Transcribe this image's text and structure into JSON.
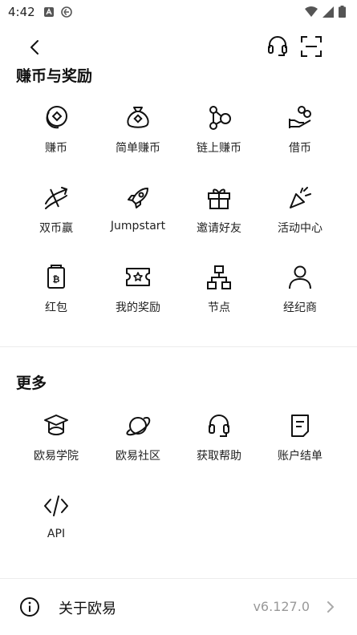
{
  "status_bar": {
    "time": "4:42"
  },
  "sections": {
    "earn": {
      "title": "赚币与奖励",
      "items": [
        {
          "label": "赚币",
          "icon": "coins-icon"
        },
        {
          "label": "简单赚币",
          "icon": "money-bag-icon"
        },
        {
          "label": "链上赚币",
          "icon": "chain-nodes-icon"
        },
        {
          "label": "借币",
          "icon": "hand-coins-icon"
        },
        {
          "label": "双币赢",
          "icon": "dual-arrows-icon"
        },
        {
          "label": "Jumpstart",
          "icon": "rocket-icon"
        },
        {
          "label": "邀请好友",
          "icon": "gift-icon"
        },
        {
          "label": "活动中心",
          "icon": "party-popper-icon"
        },
        {
          "label": "红包",
          "icon": "red-envelope-icon"
        },
        {
          "label": "我的奖励",
          "icon": "ticket-icon"
        },
        {
          "label": "节点",
          "icon": "network-node-icon"
        },
        {
          "label": "经纪商",
          "icon": "person-icon"
        }
      ]
    },
    "more": {
      "title": "更多",
      "items": [
        {
          "label": "欧易学院",
          "icon": "graduation-cap-icon"
        },
        {
          "label": "欧易社区",
          "icon": "planet-icon"
        },
        {
          "label": "获取帮助",
          "icon": "headset-icon"
        },
        {
          "label": "账户结单",
          "icon": "statement-icon"
        },
        {
          "label": "API",
          "icon": "code-icon"
        }
      ]
    }
  },
  "about": {
    "label": "关于欧易",
    "version": "v6.127.0"
  }
}
